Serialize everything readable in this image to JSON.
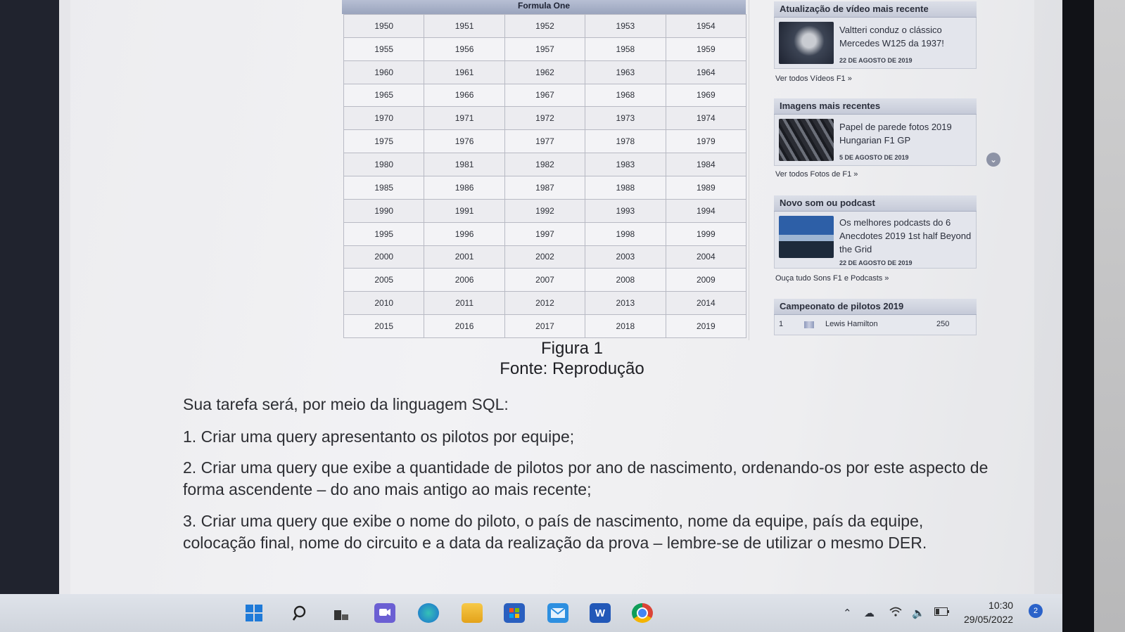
{
  "table": {
    "title": "Formula One",
    "years": [
      "1950",
      "1951",
      "1952",
      "1953",
      "1954",
      "1955",
      "1956",
      "1957",
      "1958",
      "1959",
      "1960",
      "1961",
      "1962",
      "1963",
      "1964",
      "1965",
      "1966",
      "1967",
      "1968",
      "1969",
      "1970",
      "1971",
      "1972",
      "1973",
      "1974",
      "1975",
      "1976",
      "1977",
      "1978",
      "1979",
      "1980",
      "1981",
      "1982",
      "1983",
      "1984",
      "1985",
      "1986",
      "1987",
      "1988",
      "1989",
      "1990",
      "1991",
      "1992",
      "1993",
      "1994",
      "1995",
      "1996",
      "1997",
      "1998",
      "1999",
      "2000",
      "2001",
      "2002",
      "2003",
      "2004",
      "2005",
      "2006",
      "2007",
      "2008",
      "2009",
      "2010",
      "2011",
      "2012",
      "2013",
      "2014",
      "2015",
      "2016",
      "2017",
      "2018",
      "2019"
    ]
  },
  "sidebar": {
    "video": {
      "heading": "Atualização de vídeo mais recente",
      "text": "Valtteri conduz o clássico Mercedes W125 da 1937!",
      "date": "22 DE AGOSTO DE 2019",
      "link": "Ver todos Vídeos F1 »"
    },
    "images": {
      "heading": "Imagens mais recentes",
      "text": "Papel de parede fotos 2019 Hungarian F1 GP",
      "date": "5 DE AGOSTO DE 2019",
      "link": "Ver todos Fotos de F1 »"
    },
    "podcast": {
      "heading": "Novo som ou podcast",
      "text": "Os melhores podcasts do 6 Anecdotes 2019 1st half Beyond the Grid",
      "date": "22 DE AGOSTO DE 2019",
      "link": "Ouça tudo Sons F1 e Podcasts »"
    },
    "standings": {
      "heading": "Campeonato de pilotos 2019",
      "position": "1",
      "driver": "Lewis Hamilton",
      "points": "250"
    }
  },
  "caption": {
    "line1": "Figura 1",
    "line2": "Fonte: Reprodução"
  },
  "task": {
    "intro": "Sua tarefa será, por meio da linguagem SQL:",
    "item1": "1. Criar uma query apresentanto os pilotos por equipe;",
    "item2": "2. Criar uma query que exibe a quantidade de pilotos por ano de nascimento, ordenando-os por este aspecto de forma ascendente – do ano mais antigo ao mais recente;",
    "item3": "3. Criar uma query que exibe o nome do piloto, o país de nascimento, nome da equipe, país da equipe, colocação final, nome do circuito e a data da realização da prova – lembre-se de utilizar o mesmo DER."
  },
  "taskbar": {
    "time": "10:30",
    "date": "29/05/2022",
    "notifications": "2",
    "word_label": "W"
  },
  "icons": [
    "windows-start-icon",
    "search-icon",
    "task-view-icon",
    "chat-icon",
    "edge-icon",
    "file-explorer-icon",
    "store-icon",
    "mail-icon",
    "word-icon",
    "chrome-icon",
    "chevron-up-icon",
    "onedrive-icon",
    "wifi-icon",
    "volume-icon",
    "battery-icon"
  ],
  "colors": {
    "table_header": "#9aa4bd",
    "widget_header": "#c5cad8",
    "windows_blue": "#2a62c9"
  }
}
